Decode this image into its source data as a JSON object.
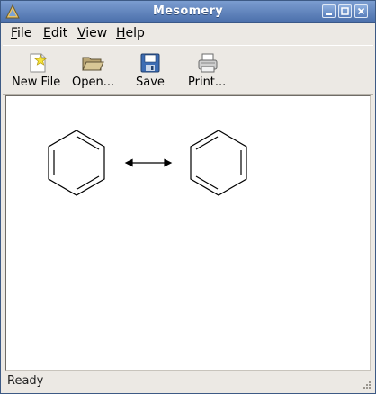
{
  "window": {
    "title": "Mesomery"
  },
  "menubar": {
    "items": [
      {
        "mnemonic": "F",
        "rest": "ile"
      },
      {
        "mnemonic": "E",
        "rest": "dit"
      },
      {
        "mnemonic": "V",
        "rest": "iew"
      },
      {
        "mnemonic": "H",
        "rest": "elp"
      }
    ]
  },
  "toolbar": {
    "new_label": "New File",
    "open_label": "Open...",
    "save_label": "Save",
    "print_label": "Print...",
    "icons": [
      "new-file-icon",
      "open-folder-icon",
      "save-disk-icon",
      "printer-icon"
    ]
  },
  "canvas": {
    "content": "two benzene Kekulé structures connected by a double-headed resonance arrow"
  },
  "status": {
    "text": "Ready"
  },
  "colors": {
    "titlebar": "#5a7fbc",
    "canvas": "#ffffff",
    "chrome": "#ece9e4"
  }
}
